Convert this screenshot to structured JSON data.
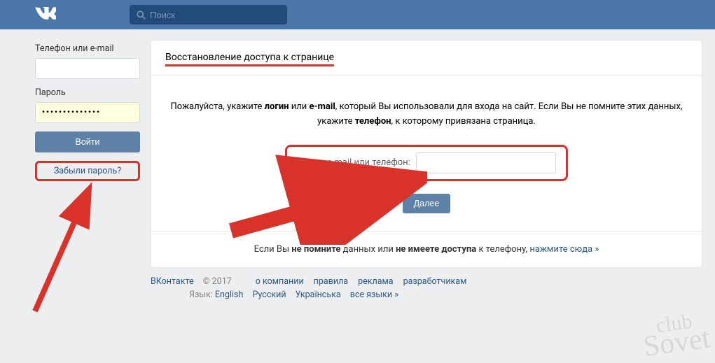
{
  "header": {
    "search_placeholder": "Поиск"
  },
  "sidebar": {
    "login_label": "Телефон или e-mail",
    "password_label": "Пароль",
    "password_value": "••••••••••••••",
    "login_button": "Войти",
    "forgot_link": "Забыли пароль?"
  },
  "main": {
    "title": "Восстановление доступа к странице",
    "instr_p1": "Пожалуйста, укажите ",
    "instr_b1": "логин",
    "instr_p2": " или ",
    "instr_b2": "e-mail",
    "instr_p3": ", который Вы использовали для входа на сайт. Если Вы не помните этих данных, укажите ",
    "instr_b3": "телефон",
    "instr_p4": ", к которому привязана страница.",
    "input_label": "Логин, e-mail или телефон:",
    "next_button": "Далее",
    "foot_p1": "Если Вы ",
    "foot_b1": "не помните",
    "foot_p2": " данных или ",
    "foot_b2": "не имеете доступа",
    "foot_p3": " к телефону, ",
    "foot_link": "нажмите сюда »"
  },
  "footer": {
    "brand": "ВКонтакте",
    "copyright": " © 2017",
    "links": {
      "about": "о компании",
      "rules": "правила",
      "ads": "реклама",
      "dev": "разработчикам"
    },
    "lang_label": "Язык:",
    "langs": {
      "en": "English",
      "ru": "Русский",
      "ua": "Українська",
      "all": "все языки »"
    }
  },
  "watermark": {
    "l1": "club",
    "l2": "Sovet"
  }
}
